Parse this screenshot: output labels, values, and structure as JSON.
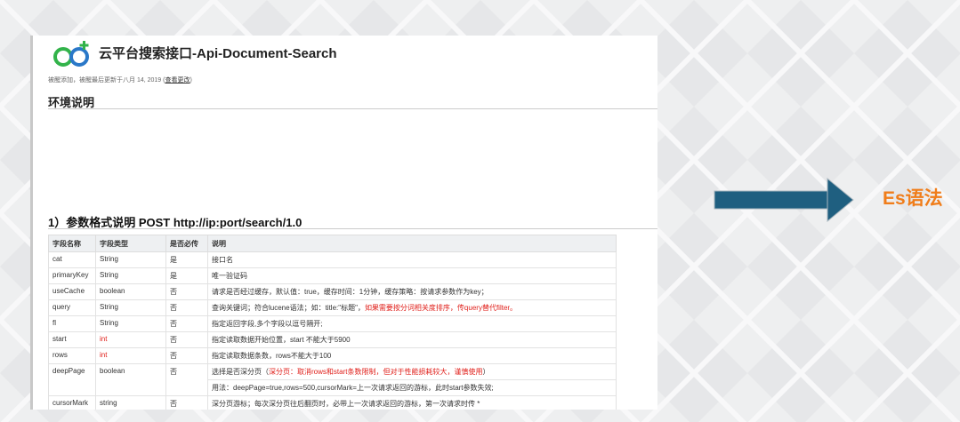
{
  "doc": {
    "title": "云平台搜索接口-Api-Document-Search",
    "meta_text": "被醒添加，被醒最后更新于八月 14, 2019",
    "meta_link": "查看更改",
    "section_env": "环境说明",
    "section_params": "1）参数格式说明 POST http://ip:port/search/1.0",
    "table": {
      "headers": [
        "字段名称",
        "字段类型",
        "是否必传",
        "说明"
      ],
      "rows": [
        {
          "name": "cat",
          "type": "String",
          "required": "是",
          "desc": "接口名",
          "desc_red": "",
          "desc2": ""
        },
        {
          "name": "primaryKey",
          "type": "String",
          "required": "是",
          "desc": "唯一验证码",
          "desc_red": "",
          "desc2": ""
        },
        {
          "name": "useCache",
          "type": "boolean",
          "required": "否",
          "desc": "请求是否经过缓存，默认值：true，缓存时间：1分钟，缓存策略：按请求参数作为key；",
          "desc_red": "",
          "desc2": ""
        },
        {
          "name": "query",
          "type": "String",
          "required": "否",
          "desc": "查询关键词；符合lucene语法；如：title:\"标题\"，",
          "desc_red": "如果需要按分词相关度排序，传query替代filter。",
          "desc2": ""
        },
        {
          "name": "fl",
          "type": "String",
          "required": "否",
          "desc": "指定返回字段,多个字段以逗号隔开;",
          "desc_red": "",
          "desc2": ""
        },
        {
          "name": "start",
          "type": "int",
          "required": "否",
          "desc": "指定读取数据开始位置，start 不能大于5900",
          "desc_red": "",
          "desc2": ""
        },
        {
          "name": "rows",
          "type": "int",
          "required": "否",
          "desc": "指定读取数据条数，rows不能大于100",
          "desc_red": "",
          "desc2": ""
        },
        {
          "name": "deepPage",
          "type": "boolean",
          "required": "否",
          "desc": "选择是否深分页（",
          "desc_red": "深分页：取消rows和start条数限制，但对于性能损耗较大，谨慎使用",
          "desc_tail": "）",
          "desc2": "用法：deepPage=true,rows=500,cursorMark=上一次请求返回的游标，此时start参数失效;"
        },
        {
          "name": "cursorMark",
          "type": "string",
          "required": "否",
          "desc": "深分页游标；每次深分页往后翻页时，必带上一次请求返回的游标，第一次请求时传 *",
          "desc_red": "",
          "desc2": ""
        }
      ]
    }
  },
  "annotation": {
    "label": "Es语法",
    "arrow_color": "#1f5f80",
    "label_color": "#f07d1a"
  },
  "colors": {
    "red_text": "#e0201b",
    "logo_green": "#32b34a",
    "logo_blue": "#2a78c8"
  }
}
